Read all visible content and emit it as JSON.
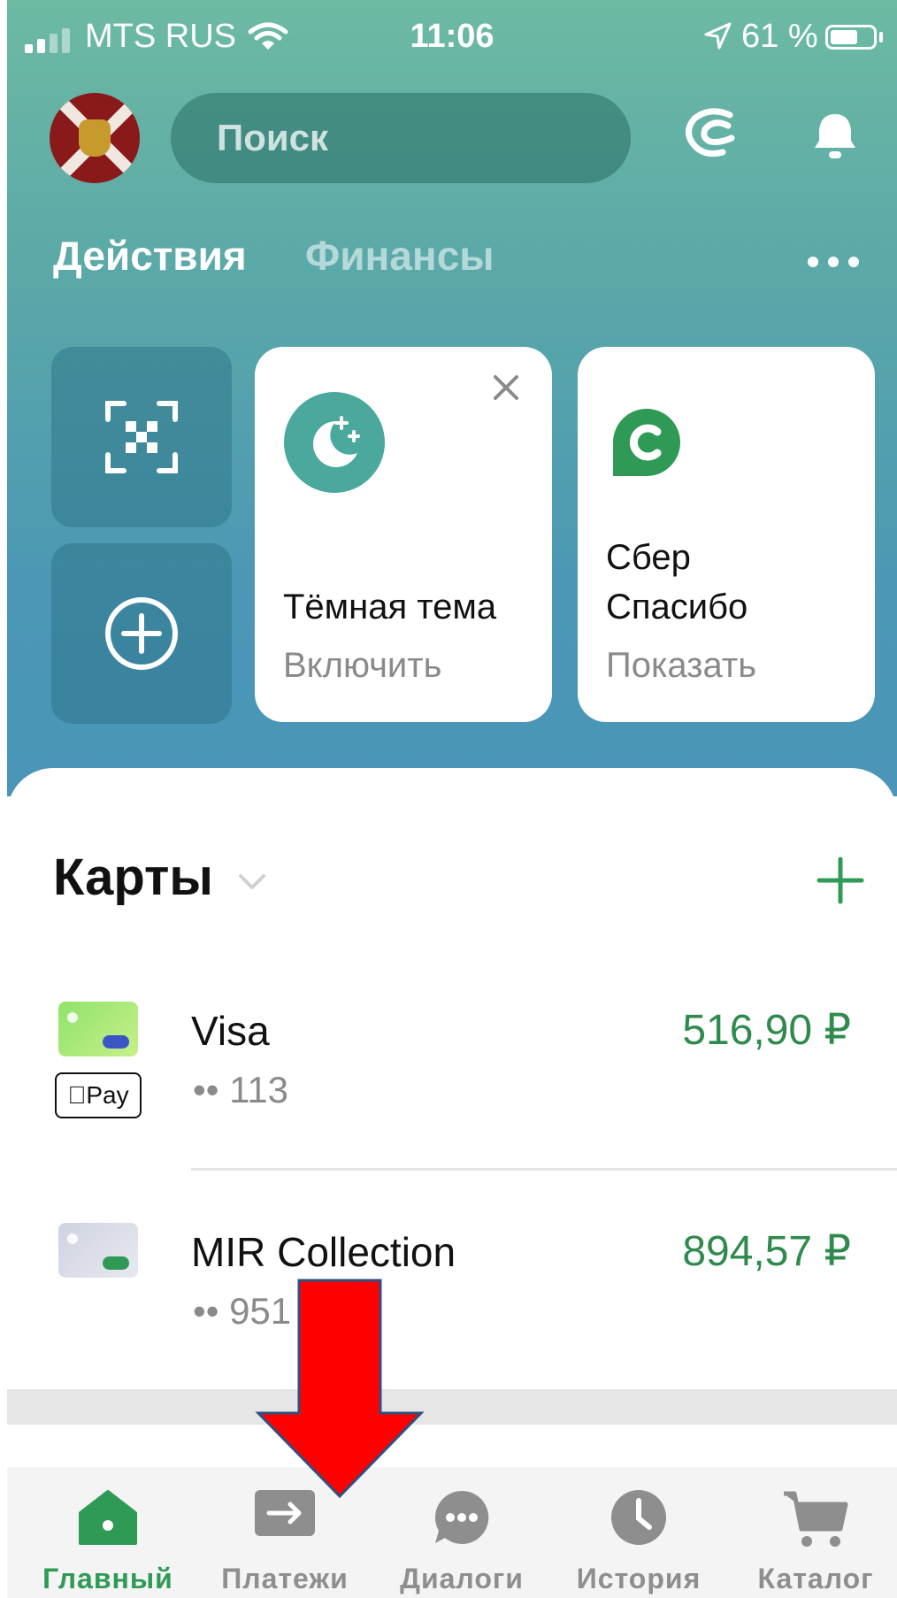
{
  "status_bar": {
    "carrier": "MTS RUS",
    "time": "11:06",
    "battery": "61 %",
    "battery_level_pct": 61,
    "signal_bars_active": 2,
    "signal_bars_total": 4
  },
  "header": {
    "search_placeholder": "Поиск"
  },
  "tabs": [
    {
      "label": "Действия",
      "active": true
    },
    {
      "label": "Финансы",
      "active": false
    }
  ],
  "tiles": {
    "qr_icon": "qr-scan-icon",
    "add_icon": "plus-circle-icon",
    "dark_theme": {
      "title": "Тёмная тема",
      "action": "Включить"
    },
    "spasibo": {
      "title_line1": "Сбер",
      "title_line2": "Спасибо",
      "action": "Показать"
    }
  },
  "cards_section": {
    "title": "Карты",
    "cards": [
      {
        "name": "Visa",
        "mask": "•• 113",
        "amount": "516,90 ₽",
        "badge": "Pay"
      },
      {
        "name": "MIR Collection",
        "mask": "•• 951",
        "amount": "894,57 ₽"
      }
    ]
  },
  "tabbar": [
    {
      "label": "Главный",
      "icon": "home-icon",
      "active": true
    },
    {
      "label": "Платежи",
      "icon": "transfer-icon",
      "active": false
    },
    {
      "label": "Диалоги",
      "icon": "chat-icon",
      "active": false
    },
    {
      "label": "История",
      "icon": "clock-icon",
      "active": false
    },
    {
      "label": "Каталог",
      "icon": "cart-icon",
      "active": false
    }
  ],
  "colors": {
    "accent_green": "#2e9a55",
    "amount_green": "#2f8a4d",
    "header_gradient_top": "#6dbaa3",
    "header_gradient_bottom": "#4a95b8",
    "annotation_arrow": "#ff0000"
  }
}
